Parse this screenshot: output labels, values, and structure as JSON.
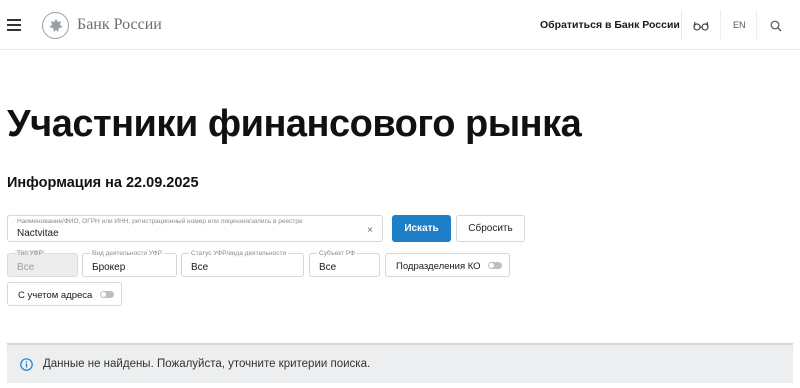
{
  "header": {
    "logo_text": "Банк России",
    "contact_link": "Обратиться в Банк России",
    "lang": "EN",
    "icons": [
      "menu-icon",
      "glasses-icon",
      "search-icon"
    ]
  },
  "page": {
    "title": "Участники финансового рынка",
    "info_date": "Информация на 22.09.2025"
  },
  "search": {
    "label": "Наименование/ФИО, ОГРН или ИНН, регистрационный номер или лицензия/запись в реестре",
    "value": "Nactvitae",
    "clear": "×",
    "submit_label": "Искать",
    "reset_label": "Сбросить"
  },
  "filters": [
    {
      "label": "Тип УФР",
      "value": "Все",
      "disabled": true
    },
    {
      "label": "Вид деятельности УФР",
      "value": "Брокер",
      "disabled": false
    },
    {
      "label": "Статус УФР/вида деятельности",
      "value": "Все",
      "disabled": false
    },
    {
      "label": "Субъект РФ",
      "value": "Все",
      "disabled": false
    }
  ],
  "toggles": {
    "subdivisions_label": "Подразделения КО",
    "subdivisions_on": false,
    "with_address_label": "С учетом адреса",
    "with_address_on": false
  },
  "notice": {
    "text": "Данные не найдены. Пожалуйста, уточните критерии поиска."
  },
  "colors": {
    "primary": "#1e7ec8",
    "notice_bg": "#eceeef"
  }
}
